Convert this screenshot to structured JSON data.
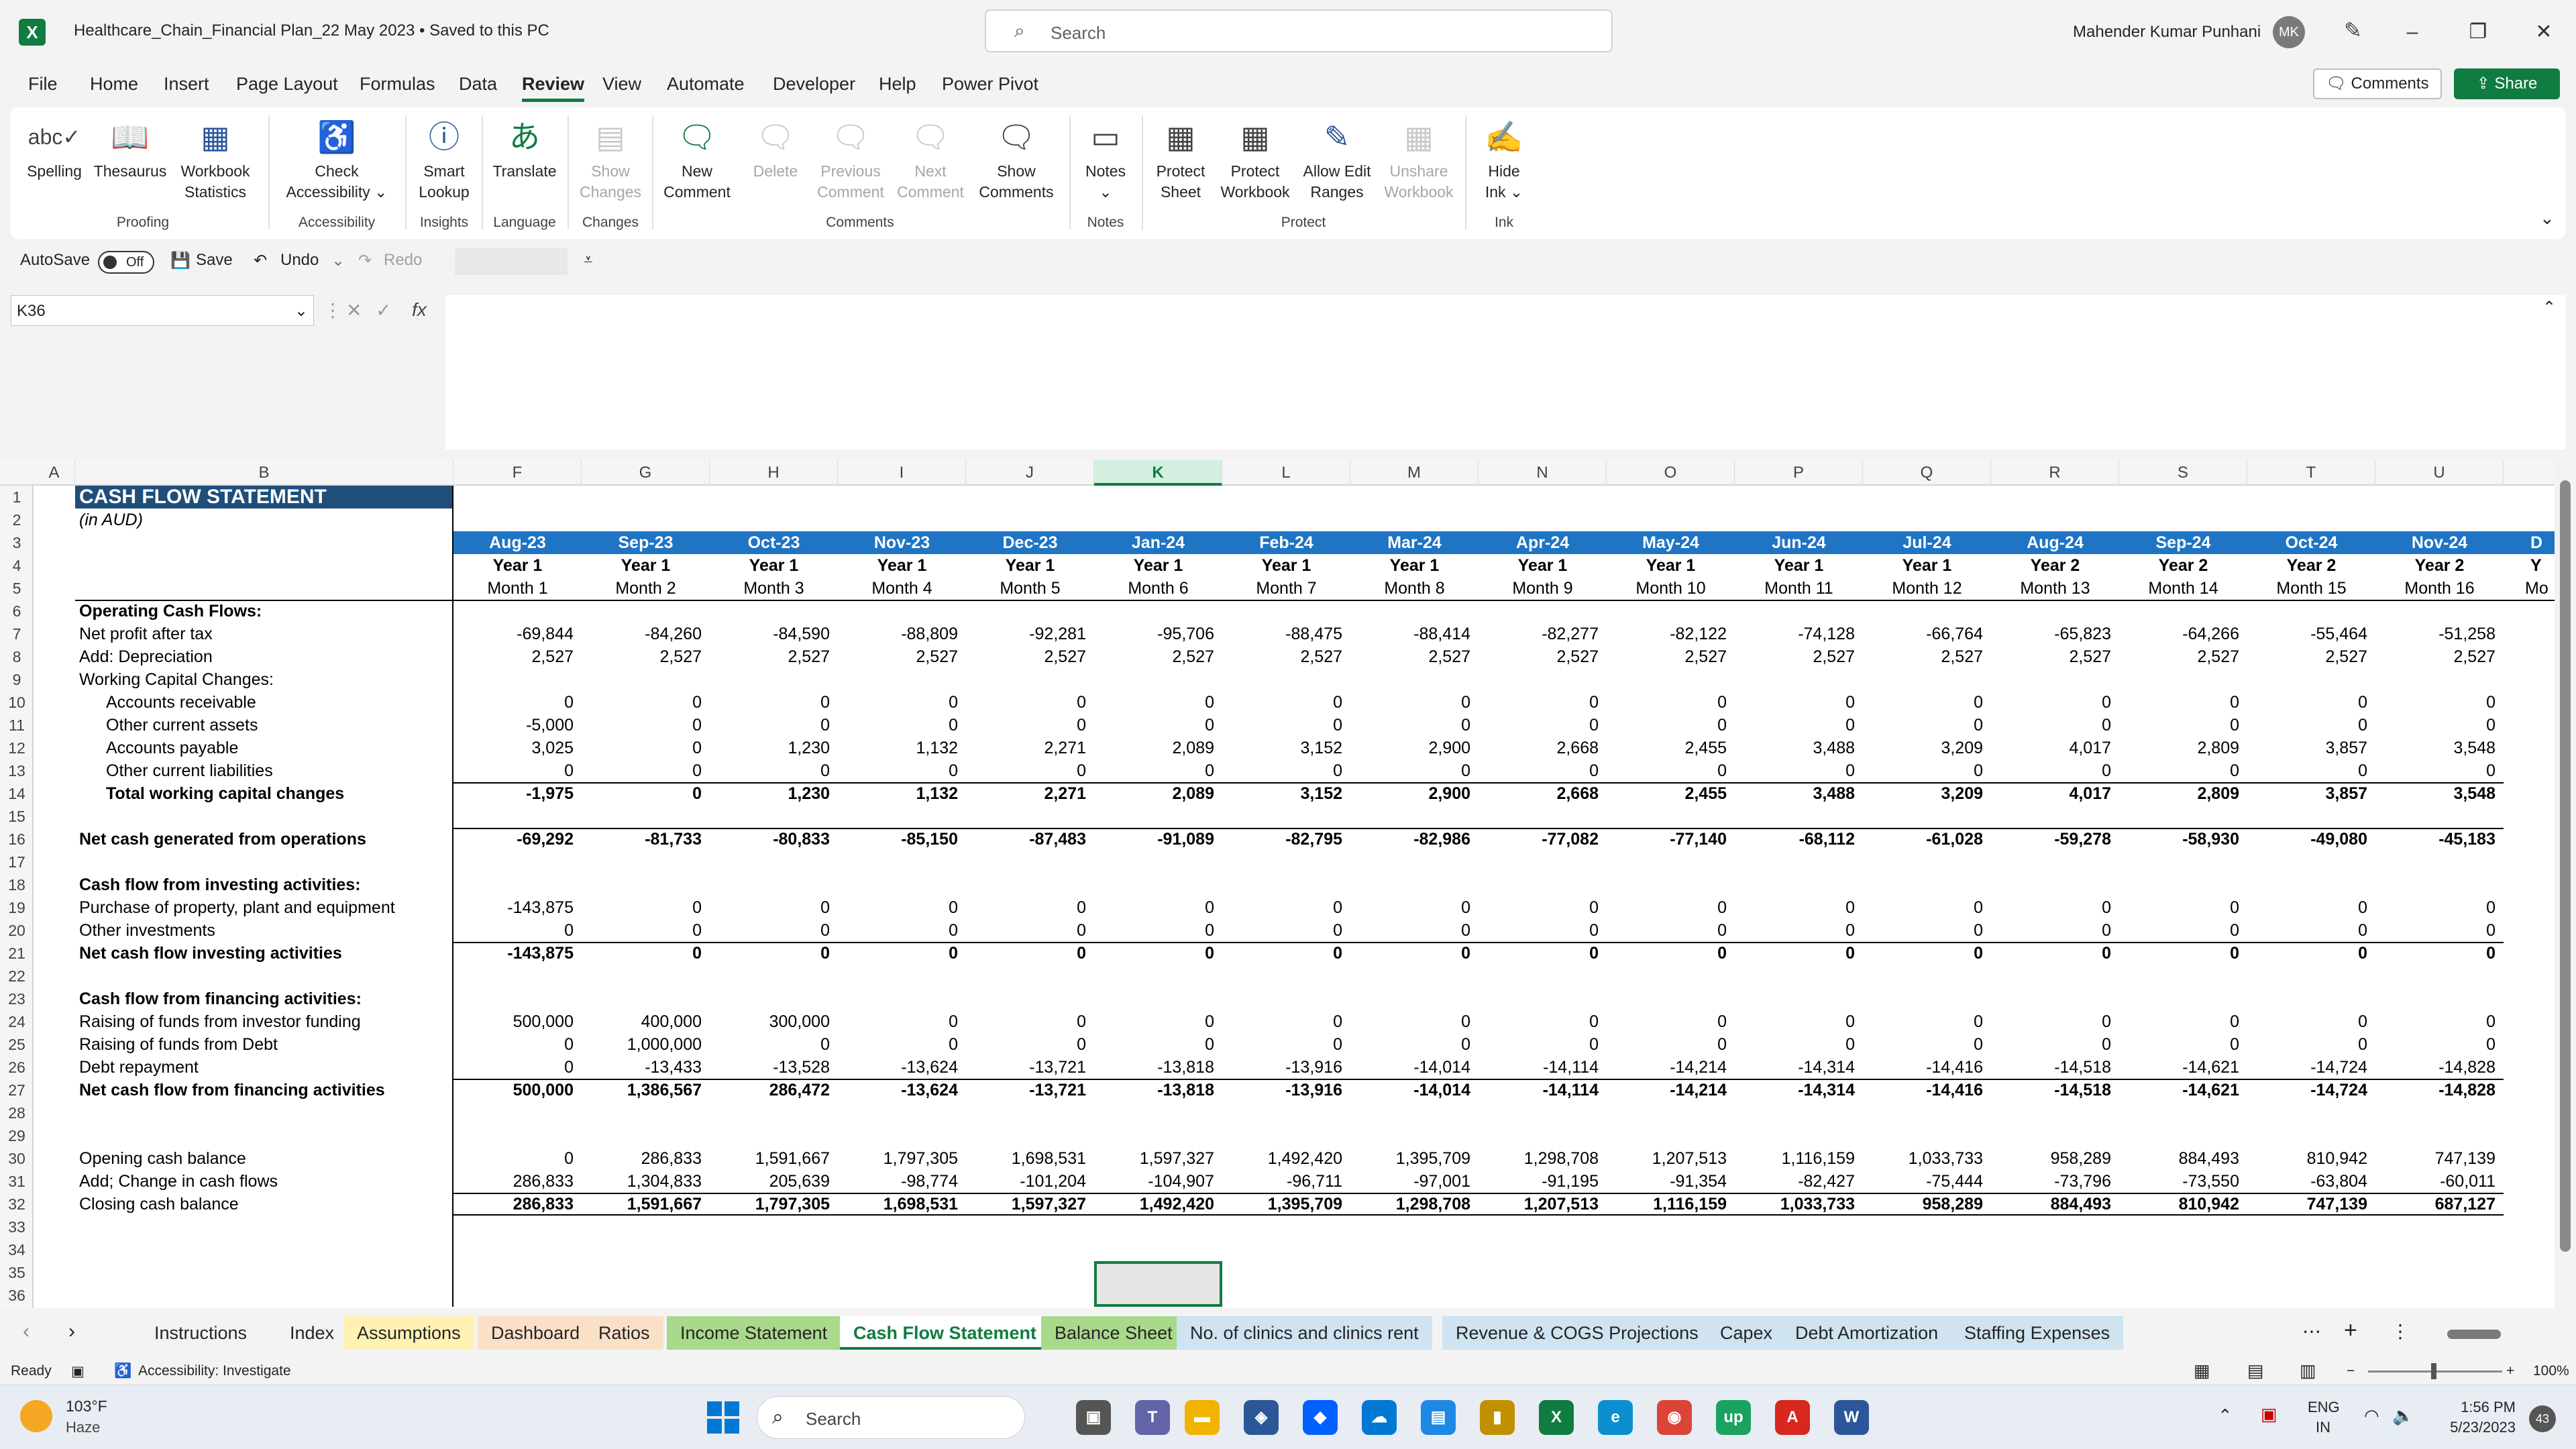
{
  "window": {
    "title": "Healthcare_Chain_Financial Plan_22 May 2023  •  Saved to this PC",
    "search_placeholder": "Search",
    "user_name": "Mahender Kumar Punhani",
    "user_initials": "MK"
  },
  "menu": [
    "File",
    "Home",
    "Insert",
    "Page Layout",
    "Formulas",
    "Data",
    "Review",
    "View",
    "Automate",
    "Developer",
    "Help",
    "Power Pivot"
  ],
  "menu_active": "Review",
  "header_buttons": {
    "comments": "Comments",
    "share": "Share"
  },
  "ribbon": {
    "spelling": "Spelling",
    "thesaurus": "Thesaurus",
    "workbook_statistics": [
      "Workbook",
      "Statistics"
    ],
    "check_accessibility": [
      "Check",
      "Accessibility"
    ],
    "smart_lookup": [
      "Smart",
      "Lookup"
    ],
    "translate": "Translate",
    "show_changes": [
      "Show",
      "Changes"
    ],
    "new_comment": [
      "New",
      "Comment"
    ],
    "delete": "Delete",
    "previous_comment": [
      "Previous",
      "Comment"
    ],
    "next_comment": [
      "Next",
      "Comment"
    ],
    "show_comments": [
      "Show",
      "Comments"
    ],
    "notes": "Notes",
    "protect_sheet": [
      "Protect",
      "Sheet"
    ],
    "protect_workbook": [
      "Protect",
      "Workbook"
    ],
    "allow_edit_ranges": [
      "Allow Edit",
      "Ranges"
    ],
    "unshare_workbook": [
      "Unshare",
      "Workbook"
    ],
    "hide_ink": [
      "Hide",
      "Ink"
    ],
    "groups": {
      "proofing": "Proofing",
      "accessibility": "Accessibility",
      "insights": "Insights",
      "language": "Language",
      "changes": "Changes",
      "comments": "Comments",
      "notes": "Notes",
      "protect": "Protect",
      "ink": "Ink"
    }
  },
  "qat": {
    "autosave": "AutoSave",
    "autosave_state": "Off",
    "save": "Save",
    "undo": "Undo",
    "redo": "Redo"
  },
  "name_box": "K36",
  "columns": [
    "A",
    "B",
    "F",
    "G",
    "H",
    "I",
    "J",
    "K",
    "L",
    "M",
    "N",
    "O",
    "P",
    "Q",
    "R",
    "S",
    "T",
    "U"
  ],
  "selected_column": "K",
  "sheet": {
    "title": "CASH FLOW STATEMENT",
    "subtitle": "(in AUD)",
    "months": [
      "Aug-23",
      "Sep-23",
      "Oct-23",
      "Nov-23",
      "Dec-23",
      "Jan-24",
      "Feb-24",
      "Mar-24",
      "Apr-24",
      "May-24",
      "Jun-24",
      "Jul-24",
      "Aug-24",
      "Sep-24",
      "Oct-24",
      "Nov-24"
    ],
    "years": [
      "Year 1",
      "Year 1",
      "Year 1",
      "Year 1",
      "Year 1",
      "Year 1",
      "Year 1",
      "Year 1",
      "Year 1",
      "Year 1",
      "Year 1",
      "Year 1",
      "Year 2",
      "Year 2",
      "Year 2",
      "Year 2"
    ],
    "month_nums": [
      "Month 1",
      "Month 2",
      "Month 3",
      "Month 4",
      "Month 5",
      "Month 6",
      "Month 7",
      "Month 8",
      "Month 9",
      "Month 10",
      "Month 11",
      "Month 12",
      "Month 13",
      "Month 14",
      "Month 15",
      "Month 16"
    ],
    "overflow_month": "D",
    "overflow_year": "Y",
    "overflow_mnum": "Mo",
    "rows": [
      {
        "r": 6,
        "label": "Operating Cash Flows:",
        "bold": true,
        "indent": 0,
        "values": []
      },
      {
        "r": 7,
        "label": "Net profit after tax",
        "indent": 0,
        "values": [
          "-69,844",
          "-84,260",
          "-84,590",
          "-88,809",
          "-92,281",
          "-95,706",
          "-88,475",
          "-88,414",
          "-82,277",
          "-82,122",
          "-74,128",
          "-66,764",
          "-65,823",
          "-64,266",
          "-55,464",
          "-51,258"
        ]
      },
      {
        "r": 8,
        "label": "Add: Depreciation",
        "indent": 0,
        "values": [
          "2,527",
          "2,527",
          "2,527",
          "2,527",
          "2,527",
          "2,527",
          "2,527",
          "2,527",
          "2,527",
          "2,527",
          "2,527",
          "2,527",
          "2,527",
          "2,527",
          "2,527",
          "2,527"
        ]
      },
      {
        "r": 9,
        "label": "Working Capital Changes:",
        "indent": 0,
        "values": []
      },
      {
        "r": 10,
        "label": "Accounts receivable",
        "indent": 1,
        "values": [
          "0",
          "0",
          "0",
          "0",
          "0",
          "0",
          "0",
          "0",
          "0",
          "0",
          "0",
          "0",
          "0",
          "0",
          "0",
          "0"
        ]
      },
      {
        "r": 11,
        "label": "Other current assets",
        "indent": 1,
        "values": [
          "-5,000",
          "0",
          "0",
          "0",
          "0",
          "0",
          "0",
          "0",
          "0",
          "0",
          "0",
          "0",
          "0",
          "0",
          "0",
          "0"
        ]
      },
      {
        "r": 12,
        "label": "Accounts payable",
        "indent": 1,
        "values": [
          "3,025",
          "0",
          "1,230",
          "1,132",
          "2,271",
          "2,089",
          "3,152",
          "2,900",
          "2,668",
          "2,455",
          "3,488",
          "3,209",
          "4,017",
          "2,809",
          "3,857",
          "3,548"
        ]
      },
      {
        "r": 13,
        "label": "Other current liabilities",
        "indent": 1,
        "values": [
          "0",
          "0",
          "0",
          "0",
          "0",
          "0",
          "0",
          "0",
          "0",
          "0",
          "0",
          "0",
          "0",
          "0",
          "0",
          "0"
        ]
      },
      {
        "r": 14,
        "label": "Total working capital changes",
        "bold": true,
        "indent": 1,
        "topline": true,
        "values": [
          "-1,975",
          "0",
          "1,230",
          "1,132",
          "2,271",
          "2,089",
          "3,152",
          "2,900",
          "2,668",
          "2,455",
          "3,488",
          "3,209",
          "4,017",
          "2,809",
          "3,857",
          "3,548"
        ]
      },
      {
        "r": 16,
        "label": "Net cash generated from operations",
        "bold": true,
        "indent": 0,
        "topline": true,
        "values": [
          "-69,292",
          "-81,733",
          "-80,833",
          "-85,150",
          "-87,483",
          "-91,089",
          "-82,795",
          "-82,986",
          "-77,082",
          "-77,140",
          "-68,112",
          "-61,028",
          "-59,278",
          "-58,930",
          "-49,080",
          "-45,183"
        ]
      },
      {
        "r": 18,
        "label": "Cash flow from investing activities:",
        "bold": true,
        "indent": 0,
        "values": []
      },
      {
        "r": 19,
        "label": "Purchase of property, plant and equipment",
        "indent": 0,
        "values": [
          "-143,875",
          "0",
          "0",
          "0",
          "0",
          "0",
          "0",
          "0",
          "0",
          "0",
          "0",
          "0",
          "0",
          "0",
          "0",
          "0"
        ]
      },
      {
        "r": 20,
        "label": "Other investments",
        "indent": 0,
        "values": [
          "0",
          "0",
          "0",
          "0",
          "0",
          "0",
          "0",
          "0",
          "0",
          "0",
          "0",
          "0",
          "0",
          "0",
          "0",
          "0"
        ]
      },
      {
        "r": 21,
        "label": "Net cash flow investing activities",
        "bold": true,
        "indent": 0,
        "topline": true,
        "values": [
          "-143,875",
          "0",
          "0",
          "0",
          "0",
          "0",
          "0",
          "0",
          "0",
          "0",
          "0",
          "0",
          "0",
          "0",
          "0",
          "0"
        ]
      },
      {
        "r": 23,
        "label": "Cash flow from financing activities:",
        "bold": true,
        "indent": 0,
        "values": []
      },
      {
        "r": 24,
        "label": "Raising of funds from investor funding",
        "indent": 0,
        "values": [
          "500,000",
          "400,000",
          "300,000",
          "0",
          "0",
          "0",
          "0",
          "0",
          "0",
          "0",
          "0",
          "0",
          "0",
          "0",
          "0",
          "0"
        ]
      },
      {
        "r": 25,
        "label": "Raising of funds from Debt",
        "indent": 0,
        "values": [
          "0",
          "1,000,000",
          "0",
          "0",
          "0",
          "0",
          "0",
          "0",
          "0",
          "0",
          "0",
          "0",
          "0",
          "0",
          "0",
          "0"
        ]
      },
      {
        "r": 26,
        "label": "Debt repayment",
        "indent": 0,
        "values": [
          "0",
          "-13,433",
          "-13,528",
          "-13,624",
          "-13,721",
          "-13,818",
          "-13,916",
          "-14,014",
          "-14,114",
          "-14,214",
          "-14,314",
          "-14,416",
          "-14,518",
          "-14,621",
          "-14,724",
          "-14,828"
        ]
      },
      {
        "r": 27,
        "label": "Net cash flow from financing activities",
        "bold": true,
        "indent": 0,
        "topline": true,
        "values": [
          "500,000",
          "1,386,567",
          "286,472",
          "-13,624",
          "-13,721",
          "-13,818",
          "-13,916",
          "-14,014",
          "-14,114",
          "-14,214",
          "-14,314",
          "-14,416",
          "-14,518",
          "-14,621",
          "-14,724",
          "-14,828"
        ]
      },
      {
        "r": 30,
        "label": "Opening cash balance",
        "indent": 0,
        "values": [
          "0",
          "286,833",
          "1,591,667",
          "1,797,305",
          "1,698,531",
          "1,597,327",
          "1,492,420",
          "1,395,709",
          "1,298,708",
          "1,207,513",
          "1,116,159",
          "1,033,733",
          "958,289",
          "884,493",
          "810,942",
          "747,139"
        ]
      },
      {
        "r": 31,
        "label": "Add; Change in cash flows",
        "indent": 0,
        "values": [
          "286,833",
          "1,304,833",
          "205,639",
          "-98,774",
          "-101,204",
          "-104,907",
          "-96,711",
          "-97,001",
          "-91,195",
          "-91,354",
          "-82,427",
          "-75,444",
          "-73,796",
          "-73,550",
          "-63,804",
          "-60,011"
        ]
      },
      {
        "r": 32,
        "label": "Closing cash balance",
        "bold": false,
        "indent": 0,
        "topline": true,
        "boldvals": true,
        "values": [
          "286,833",
          "1,591,667",
          "1,797,305",
          "1,698,531",
          "1,597,327",
          "1,492,420",
          "1,395,709",
          "1,298,708",
          "1,207,513",
          "1,116,159",
          "1,033,733",
          "958,289",
          "884,493",
          "810,942",
          "747,139",
          "687,127"
        ]
      }
    ]
  },
  "sheet_tabs": [
    "Instructions",
    "Index",
    "Assumptions",
    "Dashboard",
    "Ratios",
    "Income Statement",
    "Cash Flow Statement",
    "Balance Sheet",
    "No. of clinics and clinics rent",
    "Revenue & COGS Projections",
    "Capex",
    "Debt Amortization",
    "Staffing Expenses"
  ],
  "sheet_tab_colors": [
    "#f3f3f3",
    "#f3f3f3",
    "#fff2b3",
    "#fbe0c8",
    "#fbe0c8",
    "#a9d98a",
    "#ffffff",
    "#a9d98a",
    "#cfe3f1",
    "#cfe3f1",
    "#cfe3f1",
    "#cfe3f1",
    "#cfe3f1"
  ],
  "active_sheet": "Cash Flow Statement",
  "status": {
    "ready": "Ready",
    "accessibility": "Accessibility: Investigate",
    "zoom": "100%"
  },
  "taskbar": {
    "temp": "103°F",
    "weather": "Haze",
    "search": "Search",
    "lang1": "ENG",
    "lang2": "IN",
    "time": "1:56 PM",
    "date": "5/23/2023",
    "notifications": "43"
  },
  "colors": {
    "excel_green": "#107c41",
    "header_blue": "#1f74c4",
    "title_navy": "#1f4e79"
  }
}
